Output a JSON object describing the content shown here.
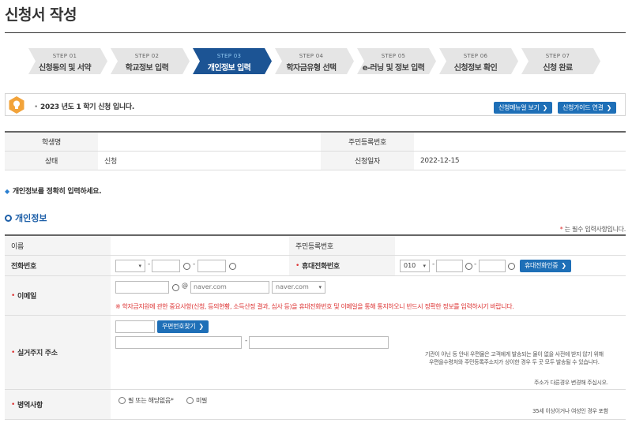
{
  "page": {
    "title": "신청서 작성"
  },
  "steps": [
    {
      "num": "STEP 01",
      "label": "신청동의 및 서약",
      "active": false
    },
    {
      "num": "STEP 02",
      "label": "학교정보 입력",
      "active": false
    },
    {
      "num": "STEP 03",
      "label": "개인정보 입력",
      "active": true
    },
    {
      "num": "STEP 04",
      "label": "학자금유형 선택",
      "active": false
    },
    {
      "num": "STEP 05",
      "label": "e-러닝 및 정보 입력",
      "active": false
    },
    {
      "num": "STEP 06",
      "label": "신청정보 확인",
      "active": false
    },
    {
      "num": "STEP 07",
      "label": "신청 완료",
      "active": false
    }
  ],
  "notice": {
    "text": "2023 년도 1 학기 신청 입니다.",
    "menu_button": "신청메뉴얼 보기",
    "guide_button": "신청가이드 연결"
  },
  "summary": {
    "student_label": "학생명",
    "student_value": "",
    "rrn_label": "주민등록번호",
    "rrn_value": "",
    "status_label": "상태",
    "status_value": "신청",
    "date_label": "신청일자",
    "date_value": "2022-12-15"
  },
  "instruction": "개인정보를 정확히 입력하세요.",
  "section": {
    "title": "개인정보",
    "required_note": "는 필수 입력사항입니다."
  },
  "form": {
    "name_label": "이름",
    "rrn_label": "주민등록번호",
    "phone_label": "전화번호",
    "mobile_label": "휴대전화번호",
    "mobile_prefix": "010",
    "mobile_verify_button": "휴대전화인증",
    "email_label": "이메일",
    "email_domain_value": "naver.com",
    "email_domain_select": "naver.com",
    "email_warning": "※ 학자금지원에 관한 중요사항(신청, 등의현황, 소득산정 결과, 심사 등)을 휴대전화번호 및 이메일을 통해 통지하오니 반드시 정확한 정보를 입력하시기 바랍니다.",
    "address_label": "실거주지 주소",
    "zip_button": "우편번호찾기",
    "address_note_1": "기관이 아닌 등 안내 우편물은 고객에게 발송되는 물이 없을 사전에 받지 않기 위해",
    "address_note_2": "우편을수령처와 주민등록주소지가 상이한 경우 두 곳 모두 발송될 수 있습니다.",
    "address_note_3": "주소가 다른경우 변경해 주십시오.",
    "military_label": "병역사항",
    "military_opt1": "필 또는 해당없음*",
    "military_opt2": "미필",
    "military_note": "35세 이상이거나 여성인 경우 포함"
  }
}
